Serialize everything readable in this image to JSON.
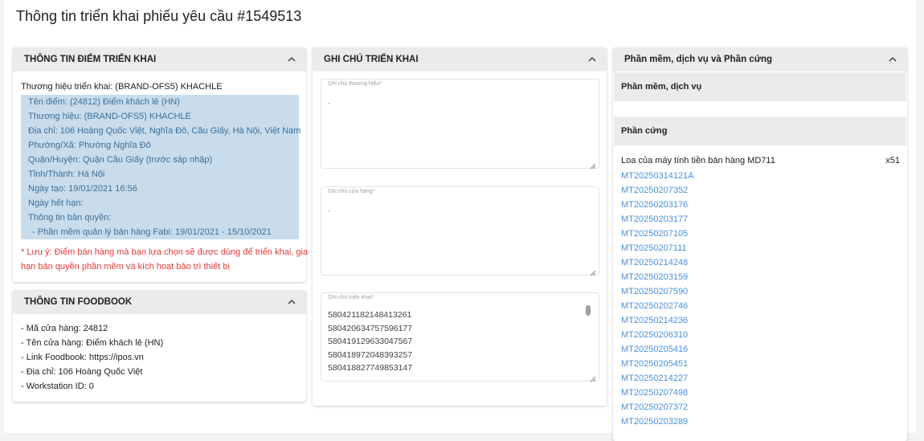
{
  "page": {
    "title": "Thông tin triển khai phiếu yêu cầu #1549513"
  },
  "location": {
    "header": "THÔNG TIN ĐIỂM TRIỂN KHAI",
    "brand_line": "Thương hiệu triển khai: (BRAND-OFS5) KHACHLE",
    "details": [
      "Tên điểm: (24812) Điểm khách lẻ (HN)",
      "Thương hiệu: (BRAND-OFS5) KHACHLE",
      "Địa chỉ: 106 Hoàng Quốc Việt, Nghĩa Đô, Cầu Giấy, Hà Nội, Việt Nam",
      "Phường/Xã: Phường Nghĩa Đô",
      "Quận/Huyện: Quận Cầu Giấy (trước sáp nhập)",
      "Tỉnh/Thành: Hà Nội",
      "Ngày tạo: 19/01/2021 16:56",
      "Ngày hết hạn:",
      "Thông tin bản quyền:",
      "- Phần mềm quản lý bán hàng Fabi: 19/01/2021 - 15/10/2021"
    ],
    "note_line1": "* Lưu ý: Điểm bán hàng mà bạn lựa chọn sẽ được dùng để triển khai, gia",
    "note_line2": "hạn bản quyền phần mềm và kích hoạt bảo trì thiết bị"
  },
  "foodbook": {
    "header": "THÔNG TIN FOODBOOK",
    "lines": [
      "- Mã cửa hàng: 24812",
      "- Tên cửa hàng: Điểm khách lẻ (HN)",
      "- Link Foodbook: https://ipos.vn",
      "- Địa chỉ: 106 Hoàng Quốc Việt",
      "- Workstation ID: 0"
    ]
  },
  "notes": {
    "header": "GHI CHÚ TRIỂN KHAI",
    "brand_note": {
      "label": "Ghi chú thương hiệu*",
      "value": "."
    },
    "store_note": {
      "label": "Ghi chú cửa hàng*",
      "value": "."
    },
    "deploy_note": {
      "label": "Ghi chú triển khai*",
      "lines": [
        "580421182148413261",
        "580420634757596177",
        "580419129633047567",
        "580418972048393257",
        "580418827749853147"
      ]
    }
  },
  "products": {
    "header": "Phần mềm, dịch vụ và Phần cứng",
    "software_header": "Phần mềm, dịch vụ",
    "hardware_header": "Phần cứng",
    "device_name": "Loa của máy tính tiền bán hàng MD711",
    "device_qty": "x51",
    "serials": [
      "MT20250314121A",
      "MT20250207352",
      "MT20250203176",
      "MT20250203177",
      "MT20250207105",
      "MT20250207111",
      "MT20250214248",
      "MT20250203159",
      "MT20250207590",
      "MT20250202746",
      "MT20250214236",
      "MT20250206310",
      "MT20250205416",
      "MT20250205451",
      "MT20250214227",
      "MT20250207498",
      "MT20250207372",
      "MT20250203289"
    ]
  }
}
